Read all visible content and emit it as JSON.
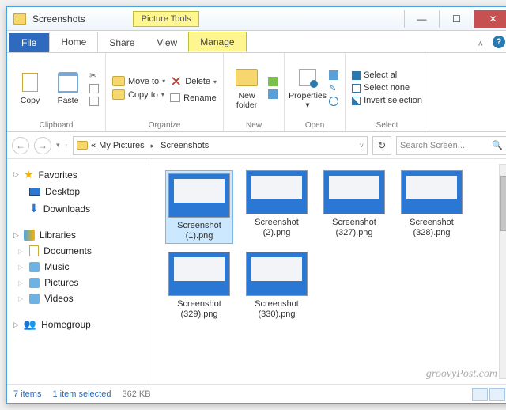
{
  "window": {
    "title": "Screenshots",
    "context_tab": "Picture Tools"
  },
  "tabs": {
    "file": "File",
    "home": "Home",
    "share": "Share",
    "view": "View",
    "manage": "Manage"
  },
  "ribbon": {
    "clipboard": {
      "label": "Clipboard",
      "copy": "Copy",
      "paste": "Paste"
    },
    "organize": {
      "label": "Organize",
      "move_to": "Move to",
      "copy_to": "Copy to",
      "delete": "Delete",
      "rename": "Rename"
    },
    "new": {
      "label": "New",
      "new_folder": "New\nfolder"
    },
    "open": {
      "label": "Open",
      "properties": "Properties"
    },
    "select": {
      "label": "Select",
      "select_all": "Select all",
      "select_none": "Select none",
      "invert": "Invert selection"
    }
  },
  "address": {
    "prefix": "«",
    "crumb1": "My Pictures",
    "crumb2": "Screenshots"
  },
  "search": {
    "placeholder": "Search Screen..."
  },
  "sidebar": {
    "favorites": "Favorites",
    "desktop": "Desktop",
    "downloads": "Downloads",
    "libraries": "Libraries",
    "documents": "Documents",
    "music": "Music",
    "pictures": "Pictures",
    "videos": "Videos",
    "homegroup": "Homegroup"
  },
  "files": [
    {
      "name": "Screenshot (1).png",
      "selected": true
    },
    {
      "name": "Screenshot (2).png",
      "selected": false
    },
    {
      "name": "Screenshot (327).png",
      "selected": false
    },
    {
      "name": "Screenshot (328).png",
      "selected": false
    },
    {
      "name": "Screenshot (329).png",
      "selected": false
    },
    {
      "name": "Screenshot (330).png",
      "selected": false
    }
  ],
  "status": {
    "items": "7 items",
    "selected": "1 item selected",
    "size": "362 KB"
  },
  "watermark": "groovyPost.com"
}
